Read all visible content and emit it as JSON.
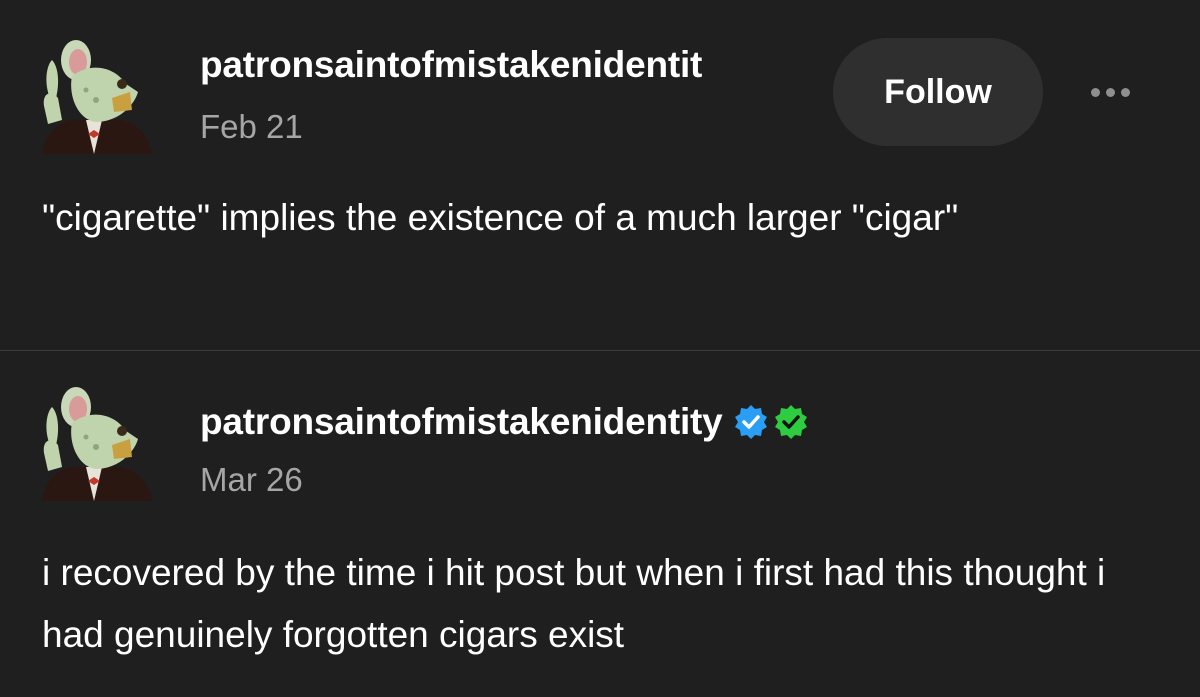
{
  "posts": [
    {
      "username": "patronsaintofmistakenidentit",
      "date": "Feb 21",
      "text": "\"cigarette\" implies the existence of a much larger \"cigar\"",
      "follow_label": "Follow",
      "more_icon": "ellipsis-icon"
    },
    {
      "username": "patronsaintofmistakenidentity",
      "date": "Mar 26",
      "text": "i recovered by the time i hit post but when i first had this thought i had genuinely forgotten cigars exist",
      "badges": [
        {
          "icon": "verified-check-icon",
          "color": "#2a9df4"
        },
        {
          "icon": "verified-check-icon",
          "color": "#2ecc40"
        }
      ]
    }
  ],
  "colors": {
    "background": "#1f1f1f",
    "secondary_text": "#a6a6a6",
    "button_bg": "#2f2f2f"
  }
}
